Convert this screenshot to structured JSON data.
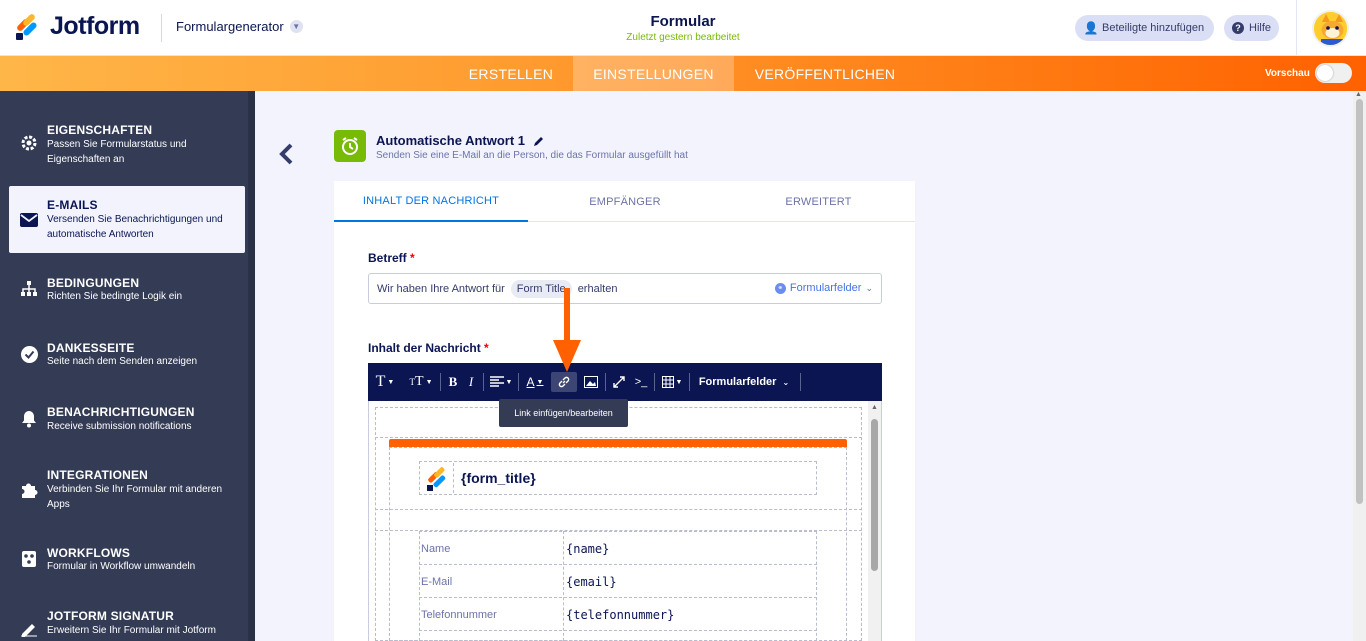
{
  "header": {
    "logo_text": "Jotform",
    "generator_label": "Formulargenerator",
    "form_title": "Formular",
    "form_subtitle": "Zuletzt gestern bearbeitet",
    "add_participants": "Beteiligte hinzufügen",
    "help": "Hilfe"
  },
  "nav": {
    "tabs": [
      "ERSTELLEN",
      "EINSTELLUNGEN",
      "VERÖFFENTLICHEN"
    ],
    "active_tab": "EINSTELLUNGEN",
    "preview_label": "Vorschau"
  },
  "sidebar": {
    "items": [
      {
        "icon": "gear-icon",
        "title": "EIGENSCHAFTEN",
        "desc": "Passen Sie Formularstatus und Eigenschaften an"
      },
      {
        "icon": "envelope-icon",
        "title": "E-MAILS",
        "desc": "Versenden Sie Benachrichtigungen und automatische Antworten",
        "active": true
      },
      {
        "icon": "sitemap-icon",
        "title": "BEDINGUNGEN",
        "desc": "Richten Sie bedingte Logik ein"
      },
      {
        "icon": "check-circle-icon",
        "title": "DANKESSEITE",
        "desc": "Seite nach dem Senden anzeigen"
      },
      {
        "icon": "bell-icon",
        "title": "BENACHRICHTIGUNGEN",
        "desc": "Receive submission notifications"
      },
      {
        "icon": "puzzle-icon",
        "title": "INTEGRATIONEN",
        "desc": "Verbinden Sie Ihr Formular mit anderen Apps"
      },
      {
        "icon": "workflow-icon",
        "title": "WORKFLOWS",
        "desc": "Formular in Workflow umwandeln"
      },
      {
        "icon": "signature-icon",
        "title": "JOTFORM SIGNATUR",
        "desc": "Erweitern Sie Ihr Formular mit Jotform"
      }
    ]
  },
  "autoresponder": {
    "title": "Automatische Antwort 1",
    "desc": "Senden Sie eine E-Mail an die Person, die das Formular ausgefüllt hat"
  },
  "tabs": [
    "INHALT DER NACHRICHT",
    "EMPFÄNGER",
    "ERWEITERT"
  ],
  "subject": {
    "label": "Betreff",
    "required": "*",
    "prefix": "Wir haben Ihre Antwort für",
    "tag": "Form Title",
    "suffix": "erhalten",
    "form_fields": "Formularfelder"
  },
  "message": {
    "label": "Inhalt der Nachricht",
    "required": "*",
    "toolbar_form_fields": "Formularfelder",
    "tooltip": "Link einfügen/bearbeiten",
    "template_title": "{form_title}",
    "rows": [
      {
        "label": "Name",
        "value": "{name}"
      },
      {
        "label": "E-Mail",
        "value": "{email}"
      },
      {
        "label": "Telefonnummer",
        "value": "{telefonnummer}"
      }
    ]
  },
  "colors": {
    "brand_orange": "#ff6100",
    "sidebar_bg": "#343c55",
    "accent_blue": "#0075e3",
    "success_green": "#78bb07",
    "toolbar_navy": "#0a1551"
  }
}
